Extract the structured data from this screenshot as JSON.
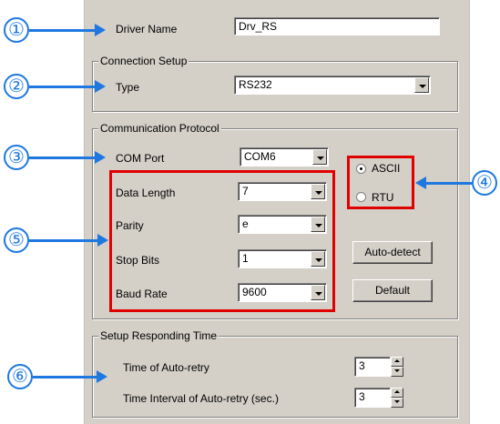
{
  "driver": {
    "label": "Driver Name",
    "value": "Drv_RS"
  },
  "connection": {
    "title": "Connection Setup",
    "type_label": "Type",
    "type_value": "RS232"
  },
  "protocol": {
    "title": "Communication Protocol",
    "com_port_label": "COM Port",
    "com_port_value": "COM6",
    "data_length_label": "Data Length",
    "data_length_value": "7",
    "parity_label": "Parity",
    "parity_value": "e",
    "stop_bits_label": "Stop Bits",
    "stop_bits_value": "1",
    "baud_rate_label": "Baud Rate",
    "baud_rate_value": "9600",
    "mode_ascii": "ASCII",
    "mode_rtu": "RTU",
    "selected_mode": "ASCII",
    "autodetect_label": "Auto-detect",
    "default_label": "Default"
  },
  "responding": {
    "title": "Setup Responding Time",
    "retry_label": "Time of Auto-retry",
    "retry_value": "3",
    "interval_label": "Time Interval of Auto-retry (sec.)",
    "interval_value": "3"
  },
  "callouts": [
    "①",
    "②",
    "③",
    "④",
    "⑤",
    "⑥"
  ],
  "colors": {
    "callout": "#1e78e0",
    "highlight": "#e00000",
    "panel": "#d4d0c8"
  }
}
